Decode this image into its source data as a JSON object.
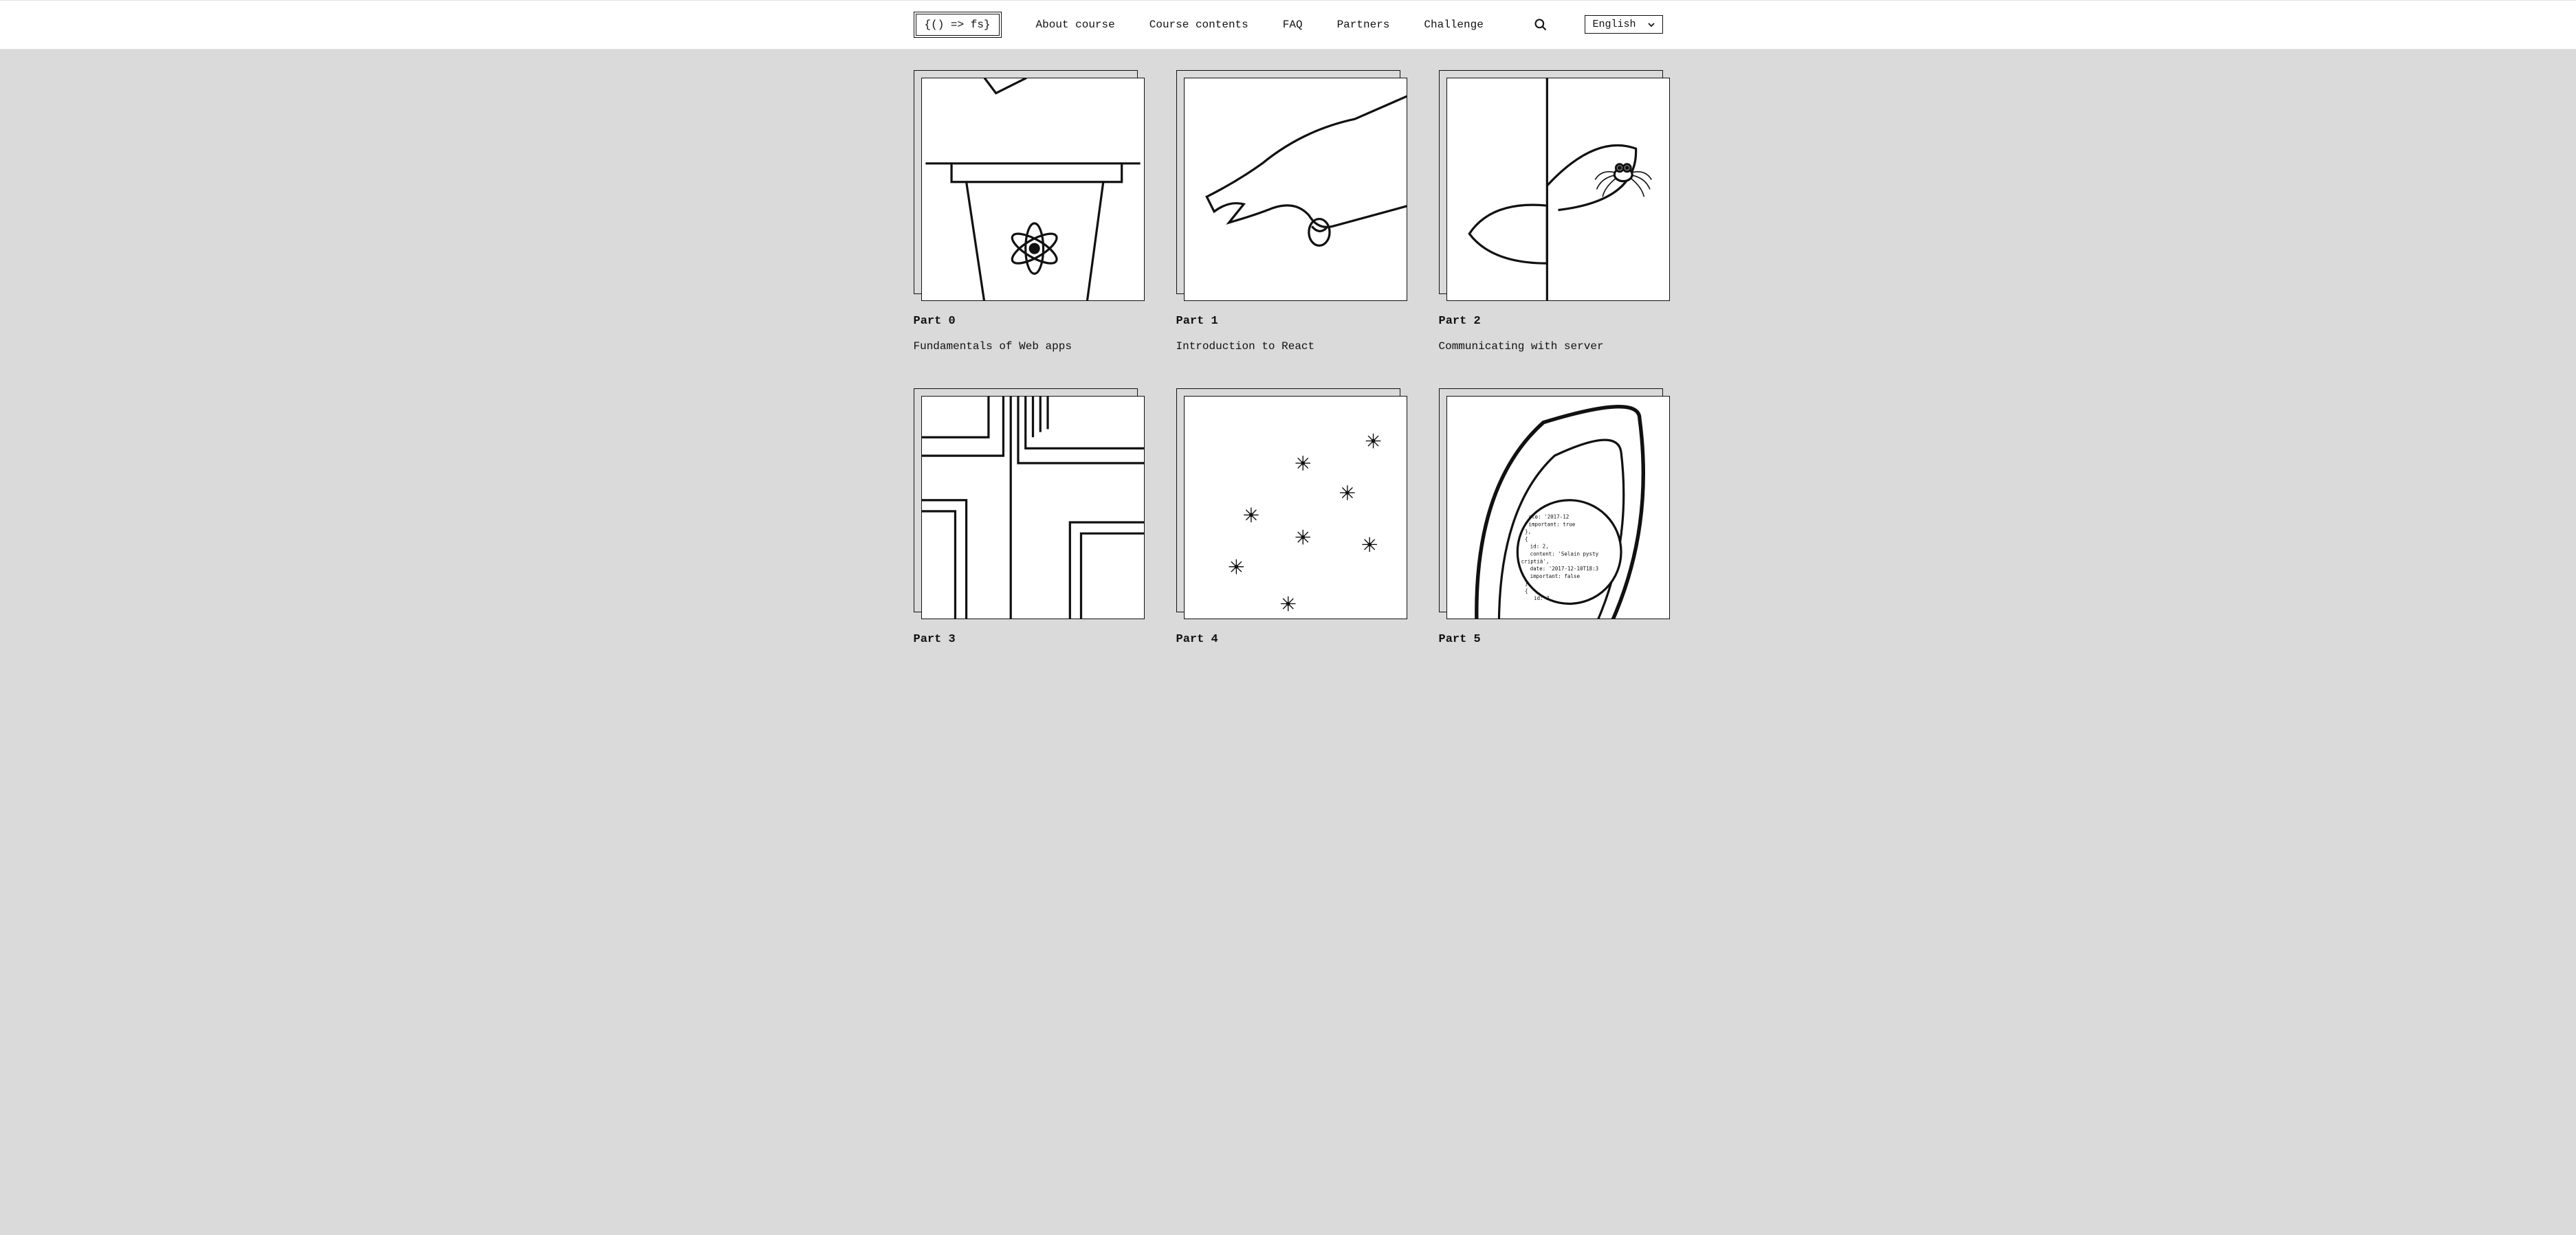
{
  "header": {
    "logo_text": "{() => fs}",
    "nav": [
      {
        "label": "About course"
      },
      {
        "label": "Course contents"
      },
      {
        "label": "FAQ"
      },
      {
        "label": "Partners"
      },
      {
        "label": "Challenge"
      }
    ],
    "language": "English"
  },
  "parts": [
    {
      "part_label": "Part 0",
      "title": "Fundamentals of Web apps"
    },
    {
      "part_label": "Part 1",
      "title": "Introduction to React"
    },
    {
      "part_label": "Part 2",
      "title": "Communicating with server"
    },
    {
      "part_label": "Part 3",
      "title": ""
    },
    {
      "part_label": "Part 4",
      "title": ""
    },
    {
      "part_label": "Part 5",
      "title": ""
    }
  ]
}
